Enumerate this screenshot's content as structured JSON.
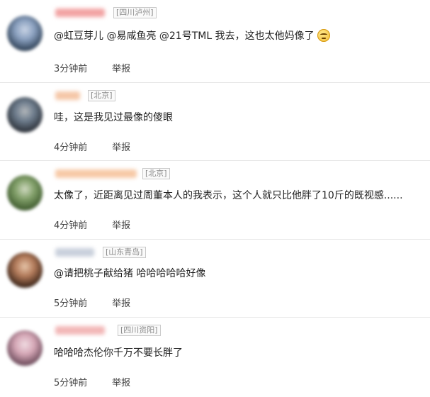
{
  "report_label": "举报",
  "comments": [
    {
      "location": "[四川泸州]",
      "text": "@虹豆芽儿 @易咸鱼亮 @21号TML 我去，这也太他妈像了",
      "time": "3分钟前",
      "emoji_icon": "frown-face-icon",
      "avatar_colors": [
        "#2f4156",
        "#8aa0bf",
        "#c9d4e5"
      ],
      "name_color": "#f2a3a3"
    },
    {
      "location": "[北京]",
      "text": "哇，这是我见过最像的傻眼",
      "time": "4分钟前",
      "avatar_colors": [
        "#2c3139",
        "#6d7c8c",
        "#b3b7bb"
      ],
      "name_color": "#f5c7a8"
    },
    {
      "location": "[北京]",
      "text": "太像了，近距离见过周董本人的我表示，这个人就只比他胖了10斤的既视感......",
      "time": "4分钟前",
      "avatar_colors": [
        "#3e5a2e",
        "#82a06a",
        "#cfd9c0"
      ],
      "name_color": "#f7c9a6"
    },
    {
      "location": "[山东青岛]",
      "text": "@请把桃子献给猪 哈哈哈哈哈好像",
      "time": "5分钟前",
      "avatar_colors": [
        "#3a2418",
        "#b27a5a",
        "#e6c4a8"
      ],
      "name_color": "#c9d0dc"
    },
    {
      "location": "[四川资阳]",
      "text": "哈哈哈杰伦你千万不要长胖了",
      "time": "5分钟前",
      "avatar_colors": [
        "#6b4a5a",
        "#d5a7b6",
        "#f0dbe2"
      ],
      "name_color": "#f2b7b7"
    }
  ]
}
